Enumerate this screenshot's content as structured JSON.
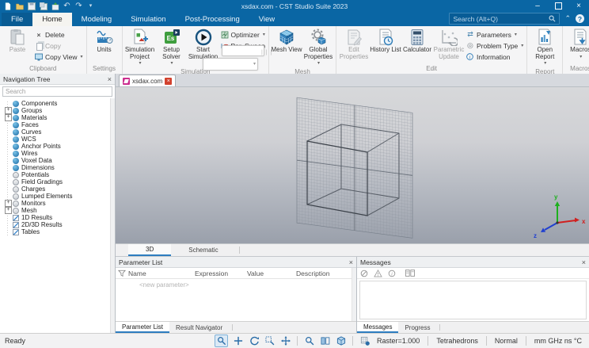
{
  "titlebar": {
    "title": "xsdax.com - CST Studio Suite 2023",
    "search_placeholder": "Search (Alt+Q)"
  },
  "ribbon_tabs": {
    "file": "File",
    "home": "Home",
    "modeling": "Modeling",
    "simulation": "Simulation",
    "post_processing": "Post-Processing",
    "view": "View"
  },
  "ribbon": {
    "clipboard": {
      "label": "Clipboard",
      "paste": "Paste",
      "delete": "Delete",
      "copy": "Copy",
      "copy_view": "Copy View"
    },
    "settings": {
      "label": "Settings",
      "units": "Units"
    },
    "simulation": {
      "label": "Simulation",
      "simulation_project": "Simulation Project",
      "setup_solver": "Setup Solver",
      "start_simulation": "Start Simulation",
      "optimizer": "Optimizer",
      "par_sweep": "Par. Sweep"
    },
    "mesh": {
      "label": "Mesh",
      "mesh_view": "Mesh View",
      "global_properties": "Global Properties"
    },
    "edit": {
      "label": "Edit",
      "edit_properties": "Edit Properties",
      "history_list": "History List",
      "calculator": "Calculator",
      "parametric_update": "Parametric Update",
      "parameters": "Parameters",
      "problem_type": "Problem Type",
      "information": "Information"
    },
    "report": {
      "label": "Report",
      "open_report": "Open Report"
    },
    "macros": {
      "label": "Macros",
      "macros": "Macros"
    }
  },
  "navigation_tree": {
    "title": "Navigation Tree",
    "search_placeholder": "Search",
    "items": [
      {
        "label": "Components"
      },
      {
        "label": "Groups"
      },
      {
        "label": "Materials"
      },
      {
        "label": "Faces"
      },
      {
        "label": "Curves"
      },
      {
        "label": "WCS"
      },
      {
        "label": "Anchor Points"
      },
      {
        "label": "Wires"
      },
      {
        "label": "Voxel Data"
      },
      {
        "label": "Dimensions"
      },
      {
        "label": "Potentials"
      },
      {
        "label": "Field Gradings"
      },
      {
        "label": "Charges"
      },
      {
        "label": "Lumped Elements"
      },
      {
        "label": "Monitors"
      },
      {
        "label": "Mesh"
      },
      {
        "label": "1D Results"
      },
      {
        "label": "2D/3D Results"
      },
      {
        "label": "Tables"
      }
    ]
  },
  "document": {
    "tab_label": "xsdax.com"
  },
  "viewport": {
    "tabs": [
      "3D",
      "Schematic"
    ],
    "active_tab": "3D",
    "axes": {
      "x": "x",
      "y": "y",
      "z": "z"
    }
  },
  "parameter_list": {
    "title": "Parameter List",
    "columns": [
      "Name",
      "Expression",
      "Value",
      "Description"
    ],
    "new_parameter_row": "<new parameter>",
    "tabs": [
      "Parameter List",
      "Result Navigator"
    ]
  },
  "messages": {
    "title": "Messages",
    "tabs": [
      "Messages",
      "Progress"
    ]
  },
  "statusbar": {
    "ready": "Ready",
    "raster": "Raster=1.000",
    "mesh_type": "Tetrahedrons",
    "render_mode": "Normal",
    "units": "mm GHz ns °C"
  },
  "colors": {
    "titlebar_blue": "#0a66a4",
    "accent_blue": "#2d7dc0",
    "close_red": "#d2422e",
    "tab_icon_pink": "#cc2f8f"
  }
}
